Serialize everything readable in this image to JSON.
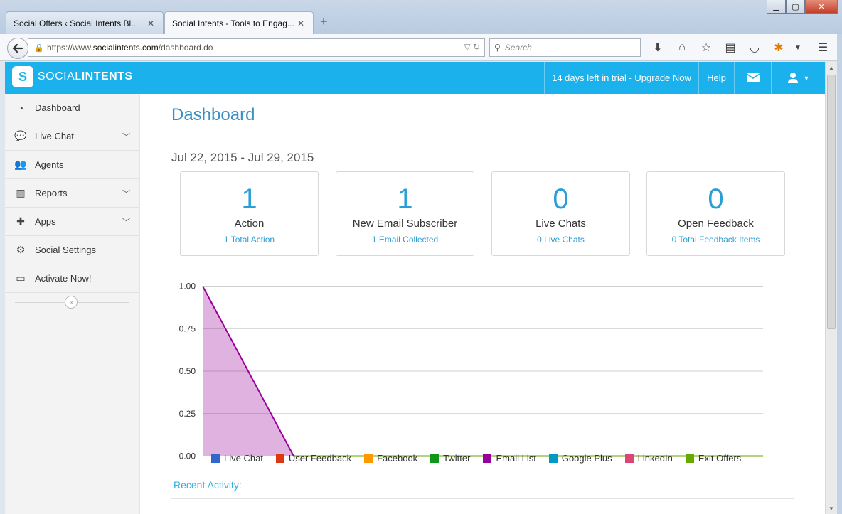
{
  "browser": {
    "tabs": [
      {
        "label": "Social Offers ‹ Social Intents Bl...",
        "active": false
      },
      {
        "label": "Social Intents - Tools to Engag...",
        "active": true
      }
    ],
    "url_prefix": "https://www.",
    "url_host": "socialintents.com",
    "url_path": "/dashboard.do",
    "search_placeholder": "Search",
    "icons": [
      "back-arrow-icon",
      "download-icon",
      "home-icon",
      "star-icon",
      "reading-list-icon",
      "pocket-icon",
      "addon-icon",
      "menu-icon"
    ]
  },
  "header": {
    "logo_prefix": "SOCIAL",
    "logo_bold": "INTENTS",
    "trial": "14 days left in trial - Upgrade Now",
    "help": "Help",
    "accent": "#1bb1ec"
  },
  "sidebar": {
    "items": [
      {
        "label": "Dashboard",
        "icon": "dashboard-icon"
      },
      {
        "label": "Live Chat",
        "icon": "chat-icon",
        "expandable": true
      },
      {
        "label": "Agents",
        "icon": "users-icon"
      },
      {
        "label": "Reports",
        "icon": "chart-icon",
        "expandable": true
      },
      {
        "label": "Apps",
        "icon": "puzzle-icon",
        "expandable": true
      },
      {
        "label": "Social Settings",
        "icon": "gear-icon"
      },
      {
        "label": "Activate Now!",
        "icon": "credit-card-icon"
      }
    ]
  },
  "main": {
    "title": "Dashboard",
    "date_range": "Jul 22, 2015 - Jul 29, 2015",
    "stats": [
      {
        "value": "1",
        "label": "Action",
        "sub": "1 Total Action"
      },
      {
        "value": "1",
        "label": "New Email Subscriber",
        "sub": "1 Email Collected"
      },
      {
        "value": "0",
        "label": "Live Chats",
        "sub": "0 Live Chats"
      },
      {
        "value": "0",
        "label": "Open Feedback",
        "sub": "0 Total Feedback Items"
      }
    ],
    "recent_label": "Recent Activity:"
  },
  "chart_data": {
    "type": "area",
    "ylim": [
      0,
      1
    ],
    "yticks": [
      "1.00",
      "0.75",
      "0.50",
      "0.25",
      "0.00"
    ],
    "x_count": 7,
    "series": [
      {
        "name": "Live Chat",
        "color": "#3366cc",
        "values": [
          0,
          0,
          0,
          0,
          0,
          0,
          0
        ]
      },
      {
        "name": "User Feedback",
        "color": "#dc3912",
        "values": [
          0,
          0,
          0,
          0,
          0,
          0,
          0
        ]
      },
      {
        "name": "Facebook",
        "color": "#ff9900",
        "values": [
          0,
          0,
          0,
          0,
          0,
          0,
          0
        ]
      },
      {
        "name": "Twitter",
        "color": "#109618",
        "values": [
          0,
          0,
          0,
          0,
          0,
          0,
          0
        ]
      },
      {
        "name": "Email List",
        "color": "#990099",
        "values": [
          1,
          0,
          0,
          0,
          0,
          0,
          0
        ]
      },
      {
        "name": "Google Plus",
        "color": "#0099c6",
        "values": [
          0,
          0,
          0,
          0,
          0,
          0,
          0
        ]
      },
      {
        "name": "LinkedIn",
        "color": "#dd4477",
        "values": [
          0,
          0,
          0,
          0,
          0,
          0,
          0
        ]
      },
      {
        "name": "Exit Offers",
        "color": "#66aa00",
        "values": [
          0,
          0,
          0,
          0,
          0,
          0,
          0
        ]
      }
    ],
    "legend_position": "bottom",
    "grid": true
  }
}
